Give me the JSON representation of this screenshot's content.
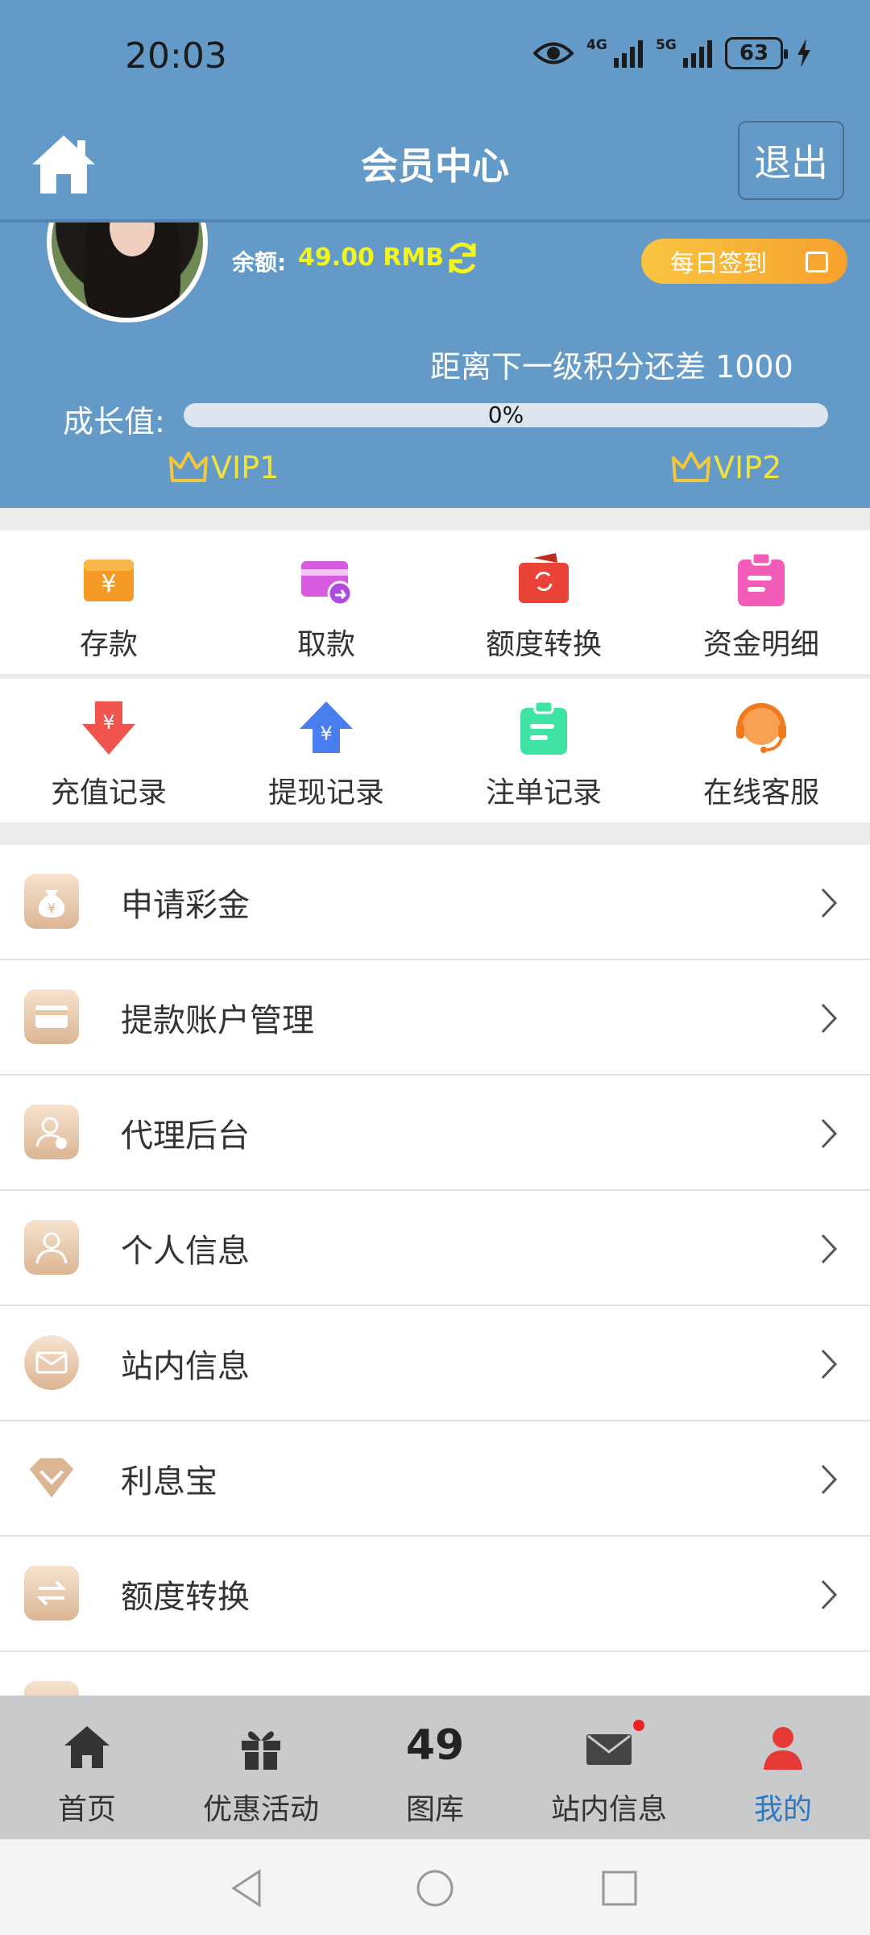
{
  "status": {
    "time": "20:03",
    "net1": "4G",
    "net2": "5G",
    "battery": "63"
  },
  "header": {
    "title": "会员中心",
    "logout": "退出"
  },
  "profile": {
    "balance_label": "余额:",
    "balance_value": "49.00 RMB",
    "signin_label": "每日签到",
    "next_level_text": "距离下一级积分还差 1000",
    "growth_label": "成长值:",
    "growth_percent_text": "0%",
    "growth_fraction": 0,
    "current_vip": "VIP1",
    "next_vip": "VIP2"
  },
  "quick_actions": [
    {
      "label": "存款",
      "icon": "deposit-icon",
      "color": "#f59a26"
    },
    {
      "label": "取款",
      "icon": "withdraw-card-icon",
      "color": "#d65be0"
    },
    {
      "label": "额度转换",
      "icon": "wallet-transfer-icon",
      "color": "#ec4338"
    },
    {
      "label": "资金明细",
      "icon": "clipboard-icon",
      "color": "#f35cb8"
    }
  ],
  "record_actions": [
    {
      "label": "充值记录",
      "icon": "down-arrow-yuan-icon",
      "color": "#f0554d"
    },
    {
      "label": "提现记录",
      "icon": "up-arrow-yuan-icon",
      "color": "#4a7df0"
    },
    {
      "label": "注单记录",
      "icon": "clipboard-icon",
      "color": "#3fe3a3"
    },
    {
      "label": "在线客服",
      "icon": "headset-icon",
      "color": "#f8a154"
    }
  ],
  "menu": [
    {
      "label": "申请彩金",
      "icon": "money-bag-icon"
    },
    {
      "label": "提款账户管理",
      "icon": "card-icon"
    },
    {
      "label": "代理后台",
      "icon": "agent-user-icon"
    },
    {
      "label": "个人信息",
      "icon": "user-icon"
    },
    {
      "label": "站内信息",
      "icon": "mail-icon"
    },
    {
      "label": "利息宝",
      "icon": "diamond-icon"
    },
    {
      "label": "额度转换",
      "icon": "transfer-arrows-icon"
    }
  ],
  "tabs": [
    {
      "label": "首页",
      "icon": "home-icon"
    },
    {
      "label": "优惠活动",
      "icon": "gift-icon"
    },
    {
      "label": "图库",
      "icon_text": "49"
    },
    {
      "label": "站内信息",
      "icon": "mail-icon"
    },
    {
      "label": "我的",
      "icon": "user-icon",
      "active": true
    }
  ]
}
